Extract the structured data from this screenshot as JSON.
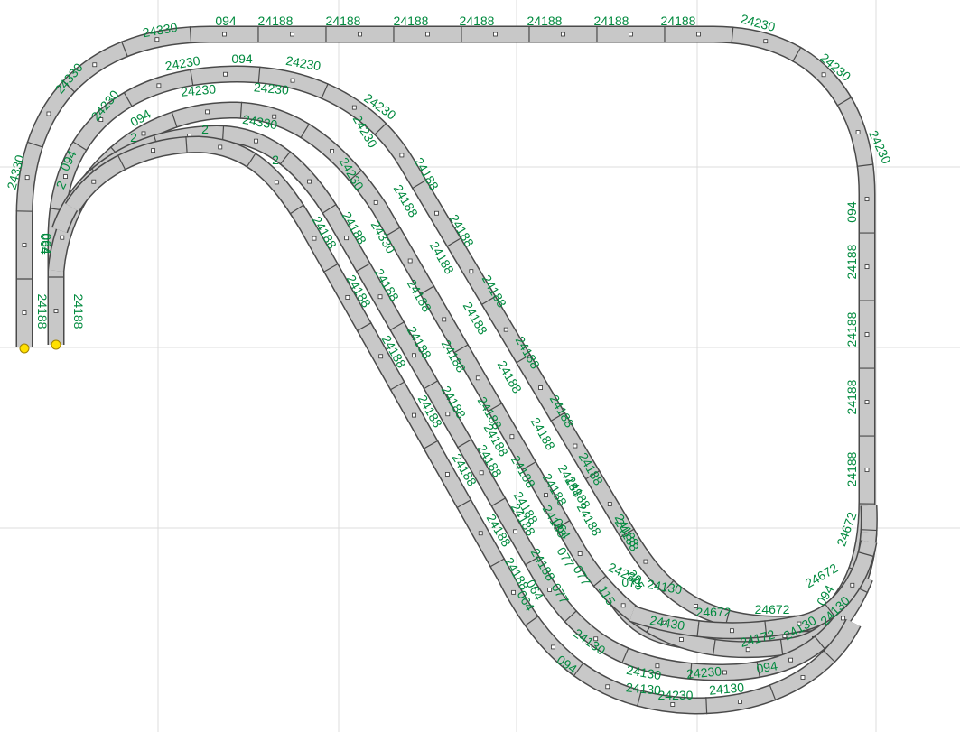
{
  "colors": {
    "background": "#ffffff",
    "grid": "#dcdcdc",
    "track_fill": "#c8c8c8",
    "track_edge": "#4a4a4a",
    "label": "#008a3e",
    "end_marker": "#ffe000"
  },
  "labels": {
    "outer_top": [
      "24330",
      "094",
      "24188",
      "24188",
      "24188",
      "24188",
      "24188",
      "24188",
      "24188",
      "24230"
    ],
    "outer_left": [
      "24330",
      "24330",
      "064",
      "24188"
    ],
    "outer_right": [
      "24230",
      "24230",
      "094",
      "24188",
      "24188",
      "24188",
      "24188",
      "24672"
    ],
    "track2_top": [
      "24230",
      "094",
      "24230",
      "24230"
    ],
    "track2_left": [
      "24230",
      "094",
      "064",
      "24188",
      "2"
    ],
    "track3_top": [
      "24230",
      "24230",
      "094"
    ],
    "track4_top": [
      "24330",
      "2",
      "2",
      "2"
    ],
    "diag_col1": [
      "24188",
      "24188",
      "24188",
      "24188",
      "24188",
      "24188",
      "24188",
      "24188",
      "24188",
      "071",
      "24188",
      "24188"
    ],
    "diag_col2": [
      "24230",
      "24188",
      "24188",
      "24188",
      "24188",
      "24188",
      "24188",
      "24188",
      "24188",
      "064",
      "077"
    ],
    "diag_col3": [
      "24230",
      "24330",
      "24188",
      "24188",
      "24188",
      "24188",
      "24188",
      "24188",
      "077",
      "077",
      "115",
      "215"
    ],
    "diag_col4": [
      "24188",
      "24188",
      "24188",
      "24188",
      "24188",
      "24188",
      "24188",
      "064",
      "064"
    ],
    "diag_col5": [
      "24188",
      "24188",
      "24188",
      "24188",
      "24188",
      "24188"
    ],
    "bottom_right": [
      "24230",
      "24130",
      "24672",
      "24672",
      "24672",
      "24430",
      "24172",
      "24130",
      "24130",
      "094",
      "24130",
      "24230",
      "24130",
      "24130",
      "24130",
      "094",
      "24230",
      "094"
    ]
  }
}
